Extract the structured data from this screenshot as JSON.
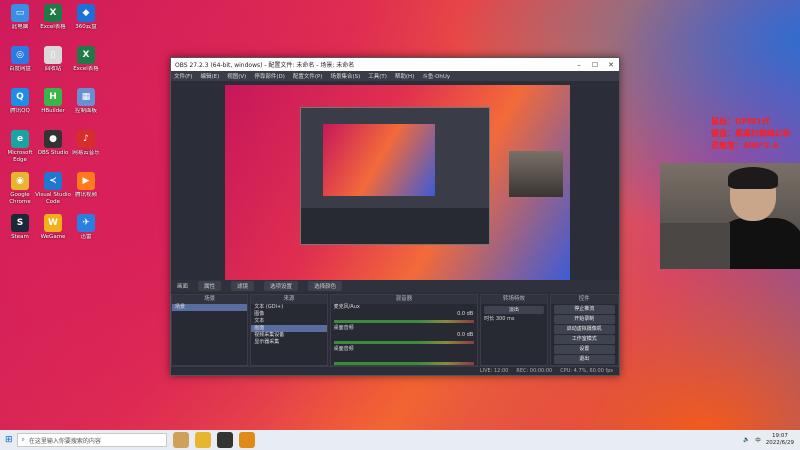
{
  "desktop": {
    "icons": [
      {
        "label": "此电脑",
        "color": "#3a8ee6",
        "glyph": "▭"
      },
      {
        "label": "Excel表格",
        "color": "#1f7a45",
        "glyph": "X"
      },
      {
        "label": "360云盘",
        "color": "#1f6fd6",
        "glyph": "◆"
      },
      {
        "label": "百度网盘",
        "color": "#2c7be5",
        "glyph": "◎"
      },
      {
        "label": "回收站",
        "color": "#d9d9d9",
        "glyph": "▯"
      },
      {
        "label": "Excel表格",
        "color": "#1f7a45",
        "glyph": "X"
      },
      {
        "label": "腾讯QQ",
        "color": "#1c8ee8",
        "glyph": "Q"
      },
      {
        "label": "HBuilder",
        "color": "#39b54a",
        "glyph": "H"
      },
      {
        "label": "控制面板",
        "color": "#6a8fd0",
        "glyph": "▦"
      },
      {
        "label": "Microsoft Edge",
        "color": "#1aa3a3",
        "glyph": "e"
      },
      {
        "label": "OBS Studio",
        "color": "#333",
        "glyph": "●"
      },
      {
        "label": "网易云音乐",
        "color": "#d62d2d",
        "glyph": "♪"
      },
      {
        "label": "Google Chrome",
        "color": "#e8b531",
        "glyph": "◉"
      },
      {
        "label": "Visual Studio Code",
        "color": "#1f77d0",
        "glyph": "≺"
      },
      {
        "label": "腾讯视频",
        "color": "#ff7a1a",
        "glyph": "▶"
      },
      {
        "label": "Steam",
        "color": "#1b2838",
        "glyph": "S"
      },
      {
        "label": "WeGame",
        "color": "#f2b11a",
        "glyph": "W"
      },
      {
        "label": "迅雷",
        "color": "#2a7fe0",
        "glyph": "✈"
      }
    ]
  },
  "obs": {
    "title": "OBS 27.2.3 (64-bit, windows) - 配置文件: 未命名 - 场景: 未命名",
    "menu": [
      "文件(F)",
      "编辑(E)",
      "视图(V)",
      "停靠部件(D)",
      "配置文件(P)",
      "场景集合(S)",
      "工具(T)",
      "帮助(H)",
      "斗鱼·OhUy"
    ],
    "source_bar": {
      "label": "画面",
      "properties": "属性",
      "filters": "滤镜",
      "source_fn": "选项设置",
      "source_fn2": "选择颜色"
    },
    "docks": {
      "scenes": {
        "header": "场景",
        "items": [
          "场景"
        ]
      },
      "sources": {
        "header": "来源",
        "items": [
          "文本 (GDI+)",
          "图像",
          "文本",
          "画面",
          "视频采集设备",
          "显示器采集"
        ]
      },
      "mixer": {
        "header": "混音器",
        "tracks": [
          {
            "name": "麦克风/Aux",
            "level": "0.0 dB"
          },
          {
            "name": "桌面音频",
            "level": "0.0 dB"
          },
          {
            "name": "桌面音频",
            "level": ""
          }
        ]
      },
      "transitions": {
        "header": "转场特效",
        "type": "淡出",
        "duration_label": "时长",
        "duration": "300 ms"
      },
      "controls": {
        "header": "控件",
        "buttons": [
          "停止推流",
          "开始录制",
          "启动虚拟摄像机",
          "工作室模式",
          "设置",
          "退出"
        ]
      }
    },
    "status": {
      "live": "LIVE: 12:00",
      "rec": "REC: 00:00:00",
      "cpu": "CPU: 4.7%, 60.00 fps"
    }
  },
  "overlay": {
    "lines": [
      "鼠标：GPW1代",
      "键盘：黑寡妇蜘蛛幻彩",
      "灵敏度：400*2.4"
    ]
  },
  "taskbar": {
    "search_placeholder": "在这里输入你要搜索的内容",
    "time": "19:07",
    "date": "2022/6/29",
    "lang": "中"
  }
}
